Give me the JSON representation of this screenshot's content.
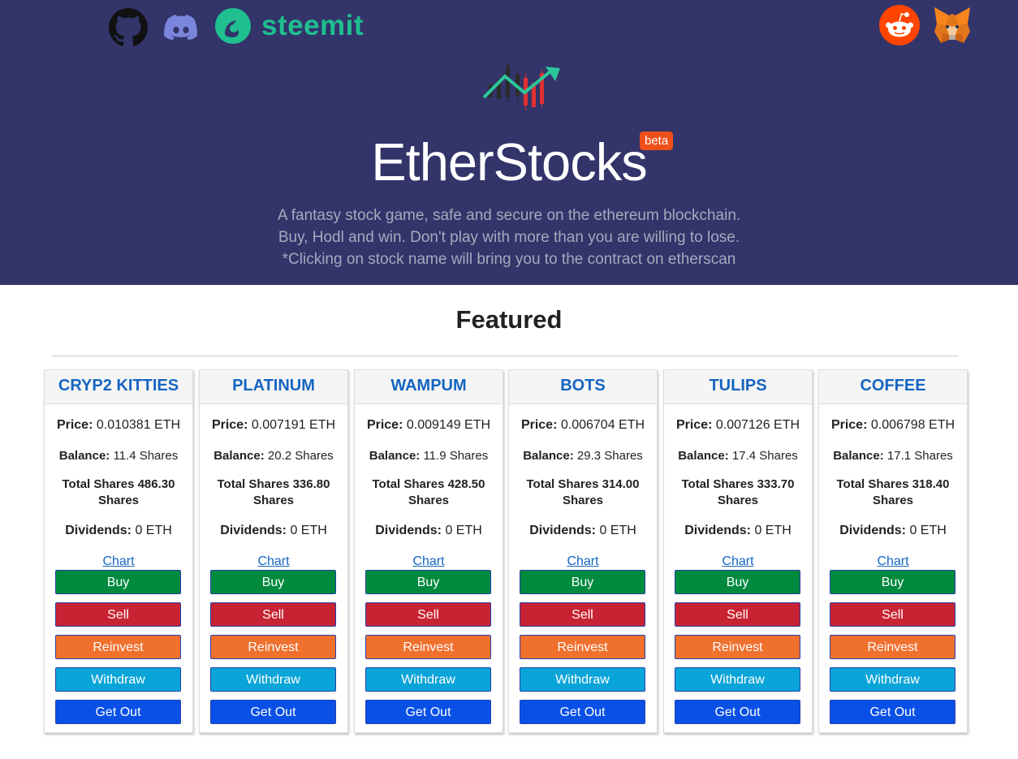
{
  "header": {
    "social": [
      {
        "name": "github-icon"
      },
      {
        "name": "discord-icon"
      },
      {
        "name": "steemit-icon",
        "label": "steemit"
      },
      {
        "name": "reddit-icon"
      },
      {
        "name": "metamask-icon"
      }
    ],
    "title": "EtherStocks",
    "badge": "beta",
    "tagline": [
      "A fantasy stock game, safe and secure on the ethereum blockchain.",
      "Buy, Hodl and win. Don't play with more than you are willing to lose.",
      "*Clicking on stock name will bring you to the contract on etherscan"
    ]
  },
  "section": {
    "title": "Featured"
  },
  "labels": {
    "price": "Price:",
    "balance": "Balance:",
    "total": "Total Shares",
    "dividends": "Dividends:",
    "chart": "Chart",
    "buy": "Buy",
    "sell": "Sell",
    "reinvest": "Reinvest",
    "withdraw": "Withdraw",
    "getout": "Get Out"
  },
  "stocks": [
    {
      "name": "CRYP2 KITTIES",
      "price": "0.010381 ETH",
      "balance": "11.4 Shares",
      "total": "486.30 Shares",
      "dividends": "0 ETH"
    },
    {
      "name": "PLATINUM",
      "price": "0.007191 ETH",
      "balance": "20.2 Shares",
      "total": "336.80 Shares",
      "dividends": "0 ETH"
    },
    {
      "name": "WAMPUM",
      "price": "0.009149 ETH",
      "balance": "11.9 Shares",
      "total": "428.50 Shares",
      "dividends": "0 ETH"
    },
    {
      "name": "BOTS",
      "price": "0.006704 ETH",
      "balance": "29.3 Shares",
      "total": "314.00 Shares",
      "dividends": "0 ETH"
    },
    {
      "name": "TULIPS",
      "price": "0.007126 ETH",
      "balance": "17.4 Shares",
      "total": "333.70 Shares",
      "dividends": "0 ETH"
    },
    {
      "name": "COFFEE",
      "price": "0.006798 ETH",
      "balance": "17.1 Shares",
      "total": "318.40 Shares",
      "dividends": "0 ETH"
    }
  ],
  "colors": {
    "hero_bg": "#32346a",
    "link": "#1565c0",
    "buy": "#008a3e",
    "sell": "#c82333",
    "reinvest": "#f0702e",
    "withdraw": "#09a4d8",
    "getout": "#0950e6",
    "beta": "#ef4f1a"
  }
}
